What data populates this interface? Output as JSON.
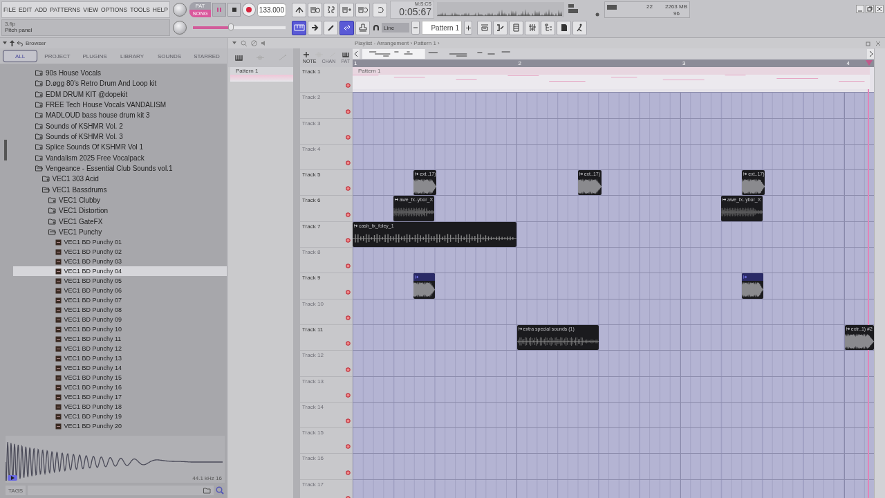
{
  "menu": [
    "FILE",
    "EDIT",
    "ADD",
    "PATTERNS",
    "VIEW",
    "OPTIONS",
    "TOOLS",
    "HELP"
  ],
  "hint_panel": {
    "file": "3.flp",
    "hint": "Pitch panel"
  },
  "transport": {
    "modes": [
      {
        "label": "PAT",
        "selected": false
      },
      {
        "label": "SONG",
        "selected": true
      }
    ],
    "tempo": "133.000",
    "time": "0:05:67",
    "time_format": "M:S:CS"
  },
  "master_pitch": {
    "level": 0.41
  },
  "monitor": {
    "readout_1": "22",
    "memory": "2263 MB",
    "readout_2": "96"
  },
  "tool_buttons": [
    {
      "selected": true
    },
    {
      "selected": false
    },
    {
      "selected": false
    },
    {
      "selected": true
    },
    {
      "selected": false
    }
  ],
  "snap": "Line",
  "pattern_selector": "Pattern 1",
  "browser": {
    "title": "Browser",
    "tabs": [
      {
        "label": "ALL",
        "selected": true
      },
      {
        "label": "PROJECT",
        "selected": false
      },
      {
        "label": "PLUGINS",
        "selected": false
      },
      {
        "label": "LIBRARY",
        "selected": false
      },
      {
        "label": "SOUNDS",
        "selected": false
      },
      {
        "label": "STARRED",
        "selected": false
      }
    ],
    "tree": [
      {
        "label": "90s House Vocals",
        "kind": "folder",
        "expanded": false,
        "selected": false
      },
      {
        "label": "D.øgg 80's Retro Drum And Loop kit",
        "kind": "folder",
        "expanded": false,
        "selected": false
      },
      {
        "label": "EDM DRUM KIT @dopekit",
        "kind": "folder",
        "expanded": false,
        "selected": false
      },
      {
        "label": "FREE Tech House Vocals VANDALISM",
        "kind": "folder",
        "expanded": false,
        "selected": false
      },
      {
        "label": "MADLOUD bass house drum kit 3",
        "kind": "folder",
        "expanded": false,
        "selected": false
      },
      {
        "label": "Sounds of KSHMR Vol. 2",
        "kind": "folder",
        "expanded": false,
        "selected": false
      },
      {
        "label": "Sounds of KSHMR Vol. 3",
        "kind": "folder",
        "expanded": false,
        "selected": false
      },
      {
        "label": "Splice Sounds Of KSHMR Vol 1",
        "kind": "folder",
        "expanded": false,
        "selected": false
      },
      {
        "label": "Vandalism 2025 Free Vocalpack",
        "kind": "folder",
        "expanded": false,
        "selected": false
      },
      {
        "label": "Vengeance - Essential Club Sounds vol.1",
        "kind": "folder",
        "expanded": true,
        "selected": false,
        "children": [
          {
            "label": "VEC1 303 Acid",
            "kind": "folder",
            "expanded": false,
            "selected": false
          },
          {
            "label": "VEC1 Bassdrums",
            "kind": "folder",
            "expanded": true,
            "selected": false,
            "children": [
              {
                "label": "VEC1 Clubby",
                "kind": "folder",
                "expanded": false,
                "selected": false
              },
              {
                "label": "VEC1 Distortion",
                "kind": "folder",
                "expanded": false,
                "selected": false
              },
              {
                "label": "VEC1 GateFX",
                "kind": "folder",
                "expanded": false,
                "selected": false
              },
              {
                "label": "VEC1 Punchy",
                "kind": "folder",
                "expanded": true,
                "selected": false,
                "children": [
                  {
                    "label": "VEC1 BD Punchy 01",
                    "kind": "file",
                    "selected": false
                  },
                  {
                    "label": "VEC1 BD Punchy 02",
                    "kind": "file",
                    "selected": false
                  },
                  {
                    "label": "VEC1 BD Punchy 03",
                    "kind": "file",
                    "selected": false
                  },
                  {
                    "label": "VEC1 BD Punchy 04",
                    "kind": "file",
                    "selected": true
                  },
                  {
                    "label": "VEC1 BD Punchy 05",
                    "kind": "file",
                    "selected": false
                  },
                  {
                    "label": "VEC1 BD Punchy 06",
                    "kind": "file",
                    "selected": false
                  },
                  {
                    "label": "VEC1 BD Punchy 07",
                    "kind": "file",
                    "selected": false
                  },
                  {
                    "label": "VEC1 BD Punchy 08",
                    "kind": "file",
                    "selected": false
                  },
                  {
                    "label": "VEC1 BD Punchy 09",
                    "kind": "file",
                    "selected": false
                  },
                  {
                    "label": "VEC1 BD Punchy 10",
                    "kind": "file",
                    "selected": false
                  },
                  {
                    "label": "VEC1 BD Punchy 11",
                    "kind": "file",
                    "selected": false
                  },
                  {
                    "label": "VEC1 BD Punchy 12",
                    "kind": "file",
                    "selected": false
                  },
                  {
                    "label": "VEC1 BD Punchy 13",
                    "kind": "file",
                    "selected": false
                  },
                  {
                    "label": "VEC1 BD Punchy 14",
                    "kind": "file",
                    "selected": false
                  },
                  {
                    "label": "VEC1 BD Punchy 15",
                    "kind": "file",
                    "selected": false
                  },
                  {
                    "label": "VEC1 BD Punchy 16",
                    "kind": "file",
                    "selected": false
                  },
                  {
                    "label": "VEC1 BD Punchy 17",
                    "kind": "file",
                    "selected": false
                  },
                  {
                    "label": "VEC1 BD Punchy 18",
                    "kind": "file",
                    "selected": false
                  },
                  {
                    "label": "VEC1 BD Punchy 19",
                    "kind": "file",
                    "selected": false
                  },
                  {
                    "label": "VEC1 BD Punchy 20",
                    "kind": "file",
                    "selected": false
                  }
                ]
              }
            ]
          }
        ]
      }
    ],
    "preview": {
      "format": "44.1 kHz 16"
    },
    "tags_label": "TAGS"
  },
  "playlist": {
    "title": "Playlist - Arrangement › Pattern 1 ›",
    "patterns": [
      "Pattern 1"
    ],
    "picker_modes": [
      "NOTE",
      "CHAN",
      "PAT"
    ],
    "ruler": [
      "1",
      "2",
      "3",
      "4"
    ],
    "tracks": [
      {
        "name": "Track 1",
        "empty": false,
        "clips": [
          {
            "label": "Pattern 1",
            "kind": "pattern"
          }
        ]
      },
      {
        "name": "Track 2",
        "empty": true
      },
      {
        "name": "Track 3",
        "empty": true
      },
      {
        "name": "Track 4",
        "empty": true
      },
      {
        "name": "Track 5",
        "empty": false,
        "clips": [
          {
            "label": "ext..17)",
            "kind": "audio"
          },
          {
            "label": "ext..17)",
            "kind": "audio"
          },
          {
            "label": "ext..17)",
            "kind": "audio"
          }
        ]
      },
      {
        "name": "Track 6",
        "empty": false,
        "clips": [
          {
            "label": "awe_fx..ybor_X",
            "kind": "audio"
          },
          {
            "label": "awe_fx..ybor_X",
            "kind": "audio"
          }
        ]
      },
      {
        "name": "Track 7",
        "empty": false,
        "clips": [
          {
            "label": "cash_fx_foley_1",
            "kind": "audio"
          }
        ]
      },
      {
        "name": "Track 8",
        "empty": true
      },
      {
        "name": "Track 9",
        "empty": false,
        "clips": [
          {
            "kind": "slice"
          },
          {
            "kind": "slice"
          }
        ]
      },
      {
        "name": "Track 10",
        "empty": true
      },
      {
        "name": "Track 11",
        "empty": false,
        "clips": [
          {
            "label": "extra special sounds (1)",
            "kind": "audio"
          },
          {
            "label": "extr..1) #2",
            "kind": "audio"
          }
        ]
      },
      {
        "name": "Track 12",
        "empty": true
      },
      {
        "name": "Track 13",
        "empty": true
      },
      {
        "name": "Track 14",
        "empty": true
      },
      {
        "name": "Track 15",
        "empty": true
      },
      {
        "name": "Track 16",
        "empty": true
      },
      {
        "name": "Track 17",
        "empty": true
      }
    ]
  }
}
